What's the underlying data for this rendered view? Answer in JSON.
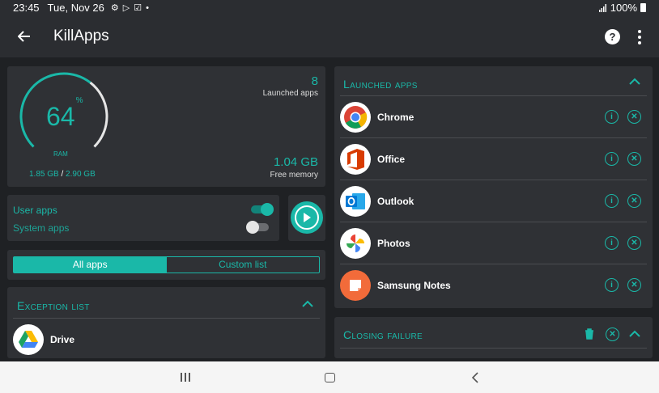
{
  "status_bar": {
    "time": "23:45",
    "date": "Tue, Nov 26",
    "battery": "100%"
  },
  "app_bar": {
    "title": "KillApps",
    "help_label": "?"
  },
  "ram": {
    "percent": "64",
    "percent_value": 64,
    "percent_sign": "%",
    "label": "RAM",
    "used": "1.85 GB",
    "separator": " / ",
    "total": "2.90 GB",
    "launched_count": "8",
    "launched_caption": "Launched apps",
    "free_value": "1.04 GB",
    "free_caption": "Free memory"
  },
  "toggles": {
    "user_apps_label": "User apps",
    "user_apps_on": true,
    "system_apps_label": "System apps",
    "system_apps_on": false
  },
  "segments": {
    "all_apps": "All apps",
    "custom_list": "Custom list",
    "selected": "all_apps"
  },
  "exception_list": {
    "title": "Exception list",
    "items": [
      {
        "name": "Drive",
        "icon": "drive-icon"
      }
    ]
  },
  "launched_apps": {
    "title": "Launched apps",
    "items": [
      {
        "name": "Chrome",
        "icon": "chrome-icon"
      },
      {
        "name": "Office",
        "icon": "office-icon"
      },
      {
        "name": "Outlook",
        "icon": "outlook-icon"
      },
      {
        "name": "Photos",
        "icon": "photos-icon"
      },
      {
        "name": "Samsung Notes",
        "icon": "samsung-notes-icon"
      }
    ]
  },
  "closing_failure": {
    "title": "Closing failure"
  },
  "colors": {
    "accent": "#1ab8a8",
    "background": "#1f2124",
    "card": "#2f3135"
  }
}
